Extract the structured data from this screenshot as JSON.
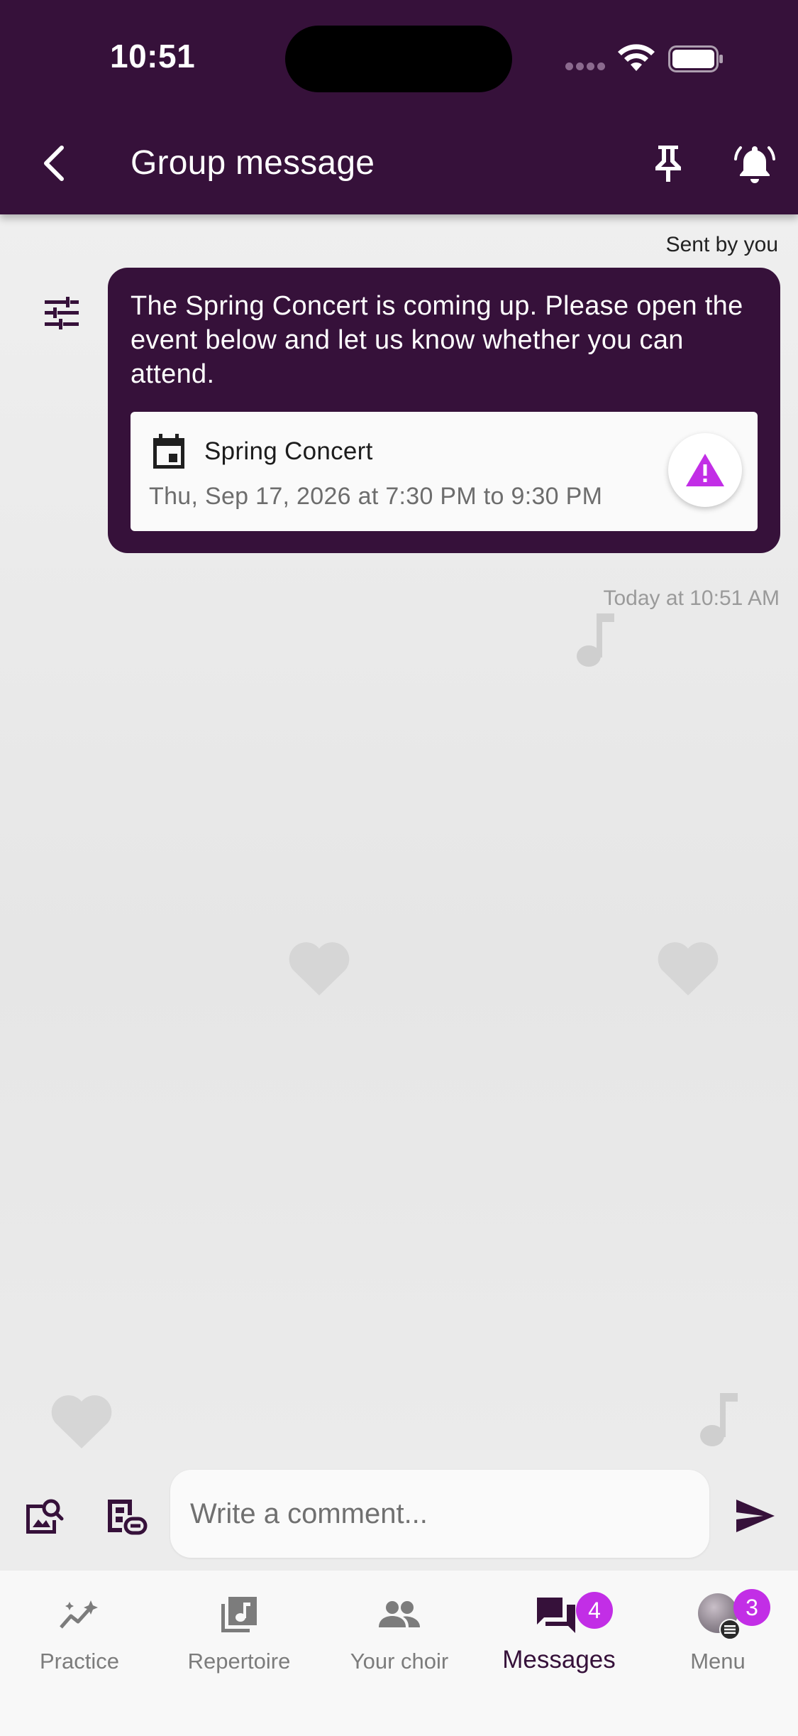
{
  "status_bar": {
    "time": "10:51"
  },
  "header": {
    "title": "Group message",
    "icons": [
      "back-chevron-icon",
      "pin-icon",
      "bell-alert-icon"
    ]
  },
  "message": {
    "sender_label": "Sent by you",
    "text": "The Spring Concert is coming up. Please open the event below and let us know whether you can attend.",
    "event": {
      "title": "Spring Concert",
      "time": "Thu, Sep 17, 2026 at 7:30 PM to 9:30 PM",
      "icon": "calendar-icon",
      "status_icon": "warning-icon"
    },
    "timestamp": "Today at 10:51 AM"
  },
  "composer": {
    "placeholder": "Write a comment..."
  },
  "bottom_nav": {
    "items": [
      {
        "label": "Practice",
        "icon": "practice-trend-icon"
      },
      {
        "label": "Repertoire",
        "icon": "music-library-icon"
      },
      {
        "label": "Your choir",
        "icon": "people-icon"
      },
      {
        "label": "Messages",
        "icon": "chat-forum-icon",
        "badge": "4",
        "active": true
      },
      {
        "label": "Menu",
        "icon": "avatar",
        "badge": "3"
      }
    ]
  },
  "colors": {
    "header_bg": "#36113a",
    "bubble_bg": "#36113a",
    "accent": "#c22ee6",
    "nav_bg": "#f8f8f8"
  }
}
